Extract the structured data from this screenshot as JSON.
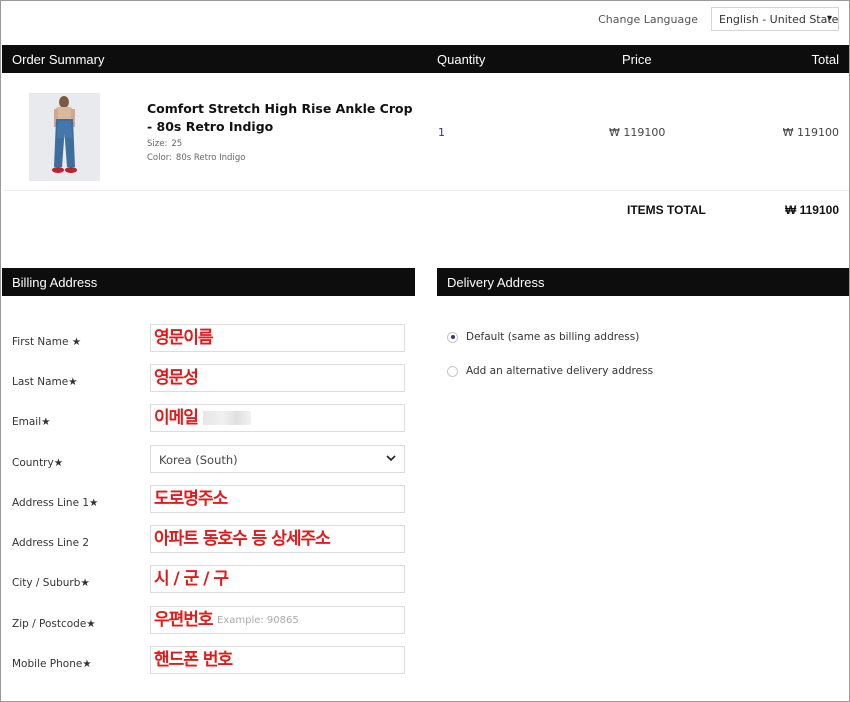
{
  "top": {
    "language_label": "Change Language",
    "language_value": "English - United States"
  },
  "order_summary": {
    "headers": {
      "order": "Order Summary",
      "quantity": "Quantity",
      "price": "Price",
      "total": "Total"
    },
    "item": {
      "name": "Comfort Stretch High Rise Ankle Crop - 80s Retro Indigo",
      "size_label": "Size:",
      "size_value": "25",
      "color_label": "Color:",
      "color_value": "80s Retro Indigo",
      "quantity": "1",
      "price": "₩ 119100",
      "total": "₩ 119100"
    },
    "items_total_label": "ITEMS TOTAL",
    "items_total_value": "₩ 119100"
  },
  "billing": {
    "title": "Billing Address",
    "fields": [
      {
        "label": "First Name ★",
        "overlay": "영문이름"
      },
      {
        "label": "Last Name★",
        "overlay": "영문성"
      },
      {
        "label": "Email★",
        "overlay": "이메일"
      },
      {
        "label": "Country★",
        "value": "Korea (South)"
      },
      {
        "label": "Address Line 1★",
        "overlay": "도로명주소"
      },
      {
        "label": "Address Line 2",
        "overlay": "아파트 동호수 등 상세주소"
      },
      {
        "label": "City / Suburb★",
        "overlay": "시 / 군 / 구"
      },
      {
        "label": "Zip / Postcode★",
        "overlay": "우편번호",
        "placeholder": "Example: 90865"
      },
      {
        "label": "Mobile Phone★",
        "overlay": "핸드폰 번호"
      }
    ]
  },
  "delivery": {
    "title": "Delivery Address",
    "options": [
      {
        "label": "Default (same as billing address)",
        "selected": true
      },
      {
        "label": "Add an alternative delivery address",
        "selected": false
      }
    ]
  },
  "colors": {
    "accent": "#4b2a78",
    "header_bg": "#0d0d0d",
    "annotation": "#e11b1b"
  },
  "icons": {
    "language_select": "chevron-down-icon",
    "country_select": "chevron-down-icon"
  }
}
